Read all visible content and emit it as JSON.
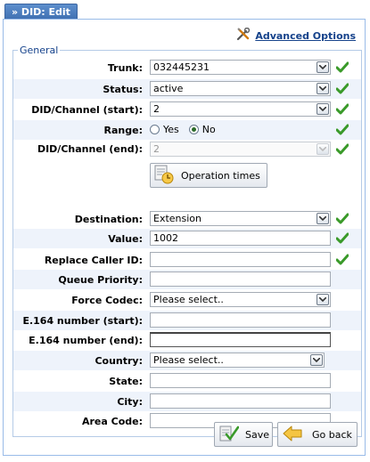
{
  "window": {
    "tab_title": "» DID: Edit"
  },
  "toolbar": {
    "advanced_options_label": "Advanced Options"
  },
  "form": {
    "legend": "General",
    "trunk": {
      "label": "Trunk:",
      "value": "032445231"
    },
    "status": {
      "label": "Status:",
      "value": "active"
    },
    "did_start": {
      "label": "DID/Channel (start):",
      "value": "2"
    },
    "range": {
      "label": "Range:",
      "yes_label": "Yes",
      "no_label": "No",
      "selected": "No"
    },
    "did_end": {
      "label": "DID/Channel (end):",
      "value": "2"
    },
    "operation_times": {
      "label": "Operation times"
    },
    "destination": {
      "label": "Destination:",
      "value": "Extension"
    },
    "value": {
      "label": "Value:",
      "value": "1002"
    },
    "replace_caller_id": {
      "label": "Replace Caller ID:",
      "value": ""
    },
    "queue_priority": {
      "label": "Queue Priority:",
      "value": ""
    },
    "force_codec": {
      "label": "Force Codec:",
      "value": "Please select.."
    },
    "e164_start": {
      "label": "E.164 number (start):",
      "value": ""
    },
    "e164_end": {
      "label": "E.164 number (end):",
      "value": ""
    },
    "country": {
      "label": "Country:",
      "value": "Please select.."
    },
    "state": {
      "label": "State:",
      "value": ""
    },
    "city": {
      "label": "City:",
      "value": ""
    },
    "area_code": {
      "label": "Area Code:",
      "value": ""
    }
  },
  "footer": {
    "save_label": "Save",
    "back_label": "Go back"
  },
  "icons": {
    "valid": "check-icon",
    "advanced": "tools-icon",
    "save": "save-icon",
    "back": "back-arrow-icon",
    "schedule": "clock-icon"
  },
  "colors": {
    "accent": "#15428b",
    "check": "#3a9a2a",
    "tab": "#4a7cc0"
  }
}
